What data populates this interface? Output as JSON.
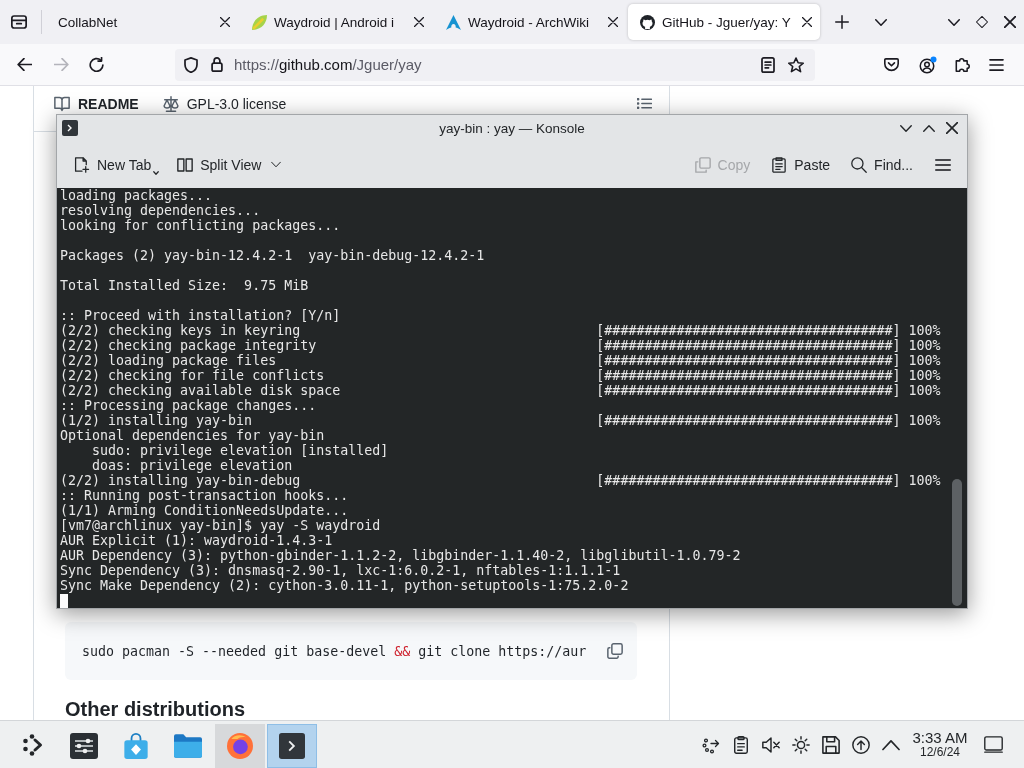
{
  "browser": {
    "tabs": [
      {
        "title": "CollabNet",
        "selected": false
      },
      {
        "title": "Waydroid | Android i",
        "selected": false
      },
      {
        "title": "Waydroid - ArchWiki",
        "selected": false
      },
      {
        "title": "GitHub - Jguer/yay: Y",
        "selected": true
      }
    ],
    "forward": {
      "disabled": true
    },
    "address": {
      "scheme": "https://",
      "host": "github.com",
      "path": "/Jguer/yay"
    }
  },
  "page": {
    "header_links": [
      {
        "label": "README",
        "selected": true
      },
      {
        "label": "GPL-3.0 license",
        "selected": false
      }
    ],
    "code": [
      {
        "kind": "plain",
        "text": "sudo pacman -S --needed git base-devel "
      },
      {
        "kind": "operator",
        "text": "&&"
      },
      {
        "kind": "plain",
        "text": " git clone https://aur"
      }
    ],
    "heading": "Other distributions"
  },
  "konsole": {
    "title": "yay-bin : yay — Konsole",
    "toolbar_left": [
      {
        "label": "New Tab"
      },
      {
        "label": "Split View"
      }
    ],
    "toolbar_right": [
      {
        "label": "Copy",
        "disabled": true
      },
      {
        "label": "Paste",
        "disabled": false
      },
      {
        "label": "Find...",
        "disabled": false
      }
    ],
    "lines": [
      {
        "kind": "text",
        "text": "loading packages..."
      },
      {
        "kind": "text",
        "text": "resolving dependencies..."
      },
      {
        "kind": "text",
        "text": "looking for conflicting packages..."
      },
      {
        "kind": "blank"
      },
      {
        "kind": "text",
        "text": "Packages (2) yay-bin-12.4.2-1  yay-bin-debug-12.4.2-1"
      },
      {
        "kind": "blank"
      },
      {
        "kind": "text",
        "text": "Total Installed Size:  9.75 MiB"
      },
      {
        "kind": "blank"
      },
      {
        "kind": "text",
        "text": ":: Proceed with installation? [Y/n]"
      },
      {
        "kind": "progress",
        "text": "(2/2) checking keys in keyring",
        "progress": "[####################################] 100%"
      },
      {
        "kind": "progress",
        "text": "(2/2) checking package integrity",
        "progress": "[####################################] 100%"
      },
      {
        "kind": "progress",
        "text": "(2/2) loading package files",
        "progress": "[####################################] 100%"
      },
      {
        "kind": "progress",
        "text": "(2/2) checking for file conflicts",
        "progress": "[####################################] 100%"
      },
      {
        "kind": "progress",
        "text": "(2/2) checking available disk space",
        "progress": "[####################################] 100%"
      },
      {
        "kind": "text",
        "text": ":: Processing package changes..."
      },
      {
        "kind": "progress",
        "text": "(1/2) installing yay-bin",
        "progress": "[####################################] 100%"
      },
      {
        "kind": "text",
        "text": "Optional dependencies for yay-bin"
      },
      {
        "kind": "indented",
        "text": "sudo: privilege elevation [installed]"
      },
      {
        "kind": "indented",
        "text": "doas: privilege elevation"
      },
      {
        "kind": "progress",
        "text": "(2/2) installing yay-bin-debug",
        "progress": "[####################################] 100%"
      },
      {
        "kind": "text",
        "text": ":: Running post-transaction hooks..."
      },
      {
        "kind": "text",
        "text": "(1/1) Arming ConditionNeedsUpdate..."
      },
      {
        "kind": "text",
        "text": "[vm7@archlinux yay-bin]$ yay -S waydroid"
      },
      {
        "kind": "text",
        "text": "AUR Explicit (1): waydroid-1.4.3-1"
      },
      {
        "kind": "text",
        "text": "AUR Dependency (3): python-gbinder-1.1.2-2, libgbinder-1.1.40-2, libglibutil-1.0.79-2"
      },
      {
        "kind": "text",
        "text": "Sync Dependency (3): dnsmasq-2.90-1, lxc-1:6.0.2-1, nftables-1:1.1.1-1"
      },
      {
        "kind": "text",
        "text": "Sync Make Dependency (2): cython-3.0.11-1, python-setuptools-1:75.2.0-2"
      },
      {
        "kind": "cursor"
      }
    ]
  },
  "taskbar": {
    "tasks": [
      {
        "running": false,
        "selected": false
      },
      {
        "running": false,
        "selected": false
      },
      {
        "running": false,
        "selected": false
      },
      {
        "running": true,
        "selected": false
      },
      {
        "running": true,
        "selected": true
      }
    ],
    "clock": {
      "time": "3:33 AM",
      "date": "12/6/24"
    }
  }
}
